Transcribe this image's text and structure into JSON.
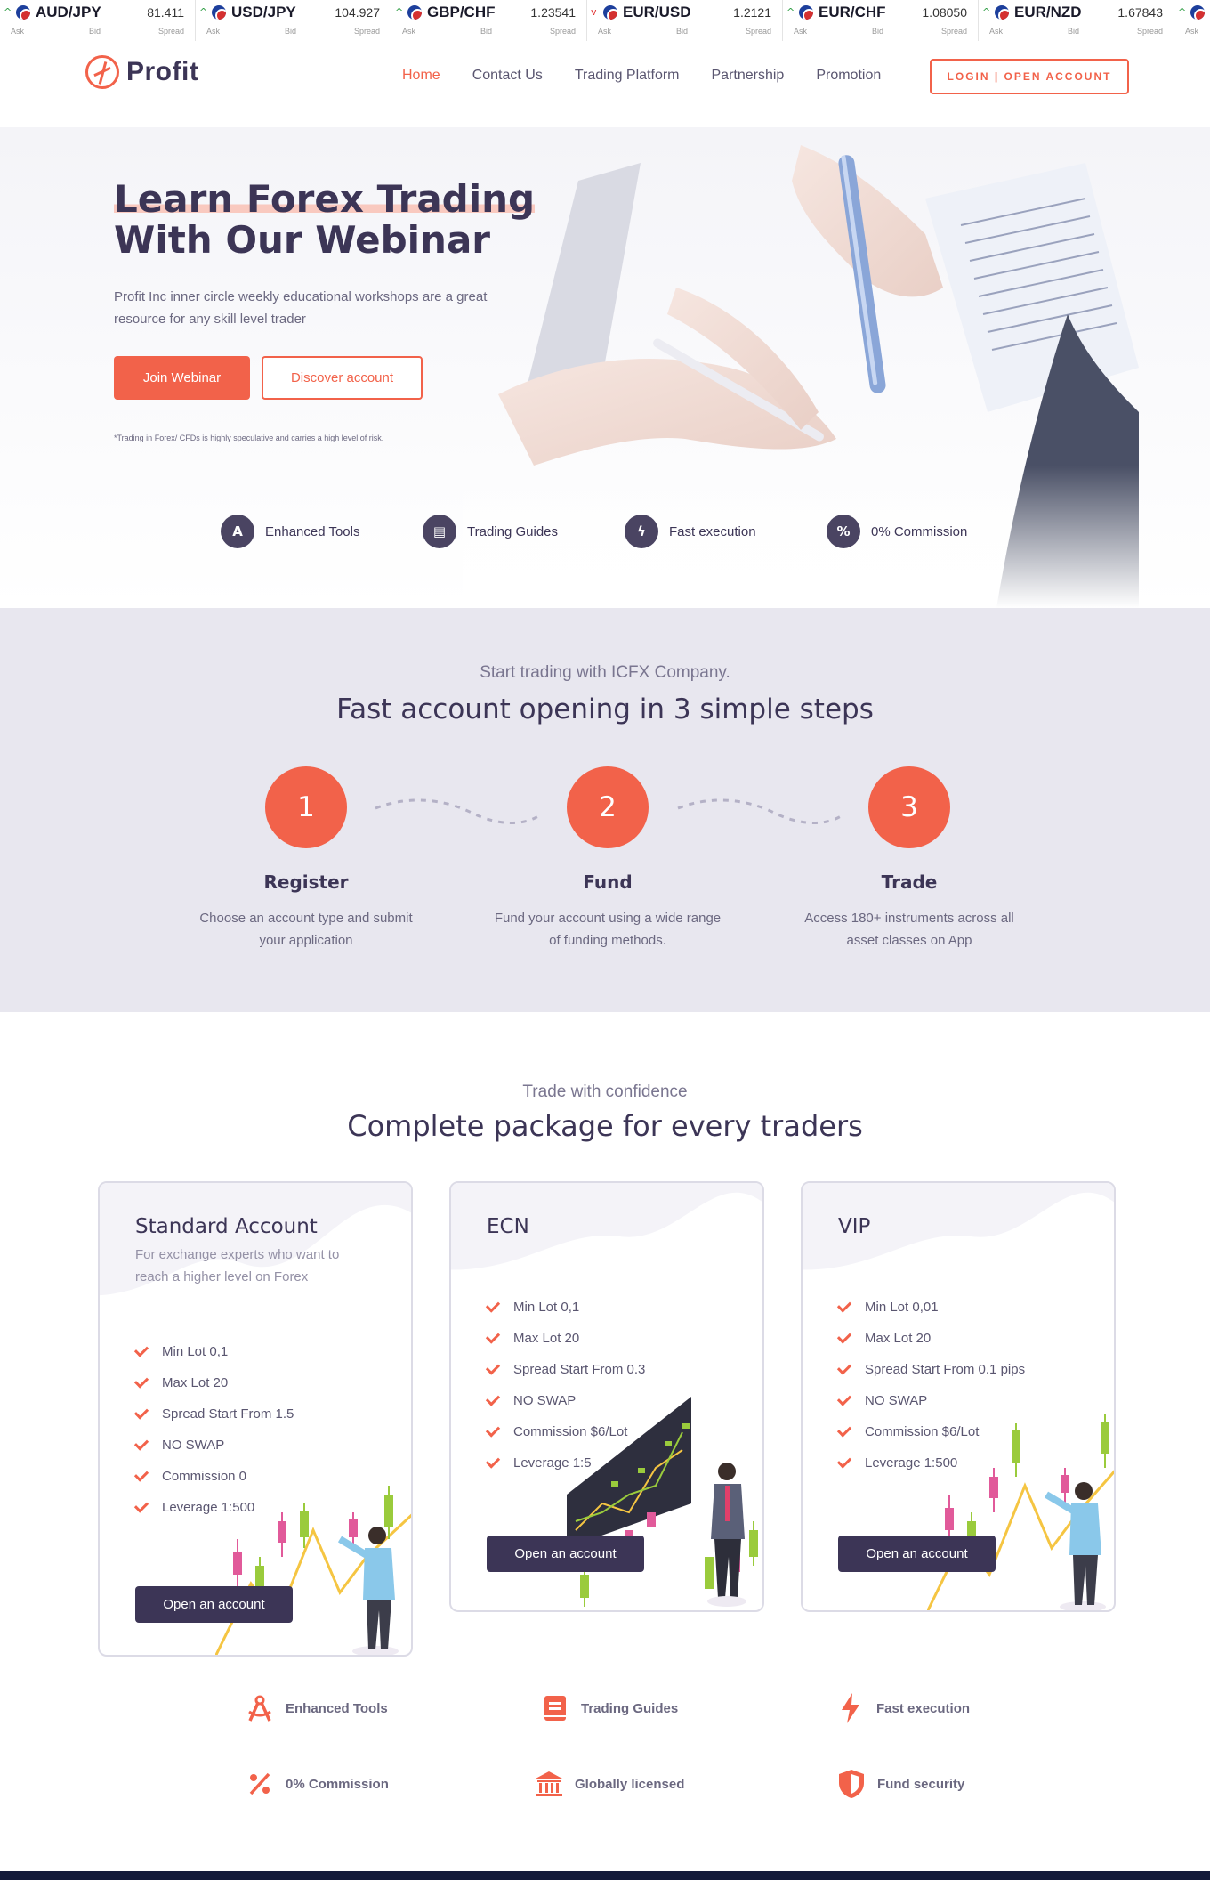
{
  "ticker": [
    {
      "pair": "AUD/JPY",
      "price": "81.411",
      "dir": "up",
      "ask": "Ask",
      "bid": "Bid",
      "spread": "Spread"
    },
    {
      "pair": "USD/JPY",
      "price": "104.927",
      "dir": "up",
      "ask": "Ask",
      "bid": "Bid",
      "spread": "Spread"
    },
    {
      "pair": "GBP/CHF",
      "price": "1.23541",
      "dir": "up",
      "ask": "Ask",
      "bid": "Bid",
      "spread": "Spread"
    },
    {
      "pair": "EUR/USD",
      "price": "1.2121",
      "dir": "down",
      "ask": "Ask",
      "bid": "Bid",
      "spread": "Spread"
    },
    {
      "pair": "EUR/CHF",
      "price": "1.08050",
      "dir": "up",
      "ask": "Ask",
      "bid": "Bid",
      "spread": "Spread"
    },
    {
      "pair": "EUR/NZD",
      "price": "1.67843",
      "dir": "up",
      "ask": "Ask",
      "bid": "Bid",
      "spread": "Spread"
    },
    {
      "pair": "",
      "price": "",
      "dir": "up",
      "ask": "Ask",
      "bid": "",
      "spread": ""
    }
  ],
  "header": {
    "logo_text": "Profit",
    "nav": [
      "Home",
      "Contact Us",
      "Trading Platform",
      "Partnership",
      "Promotion"
    ],
    "login_label": "LOGIN  |  OPEN ACCOUNT"
  },
  "hero": {
    "title_line1": "Learn Forex Trading",
    "title_line2": "With Our Webinar",
    "subtitle": "Profit Inc inner circle weekly educational workshops are a great resource for any skill level trader",
    "primary_button": "Join Webinar",
    "secondary_button": "Discover account",
    "risk_note": "*Trading in Forex/ CFDs is highly speculative and carries a high level of risk.",
    "features": [
      {
        "label": "Enhanced Tools",
        "icon": "compass-icon"
      },
      {
        "label": "Trading Guides",
        "icon": "book-icon"
      },
      {
        "label": "Fast execution",
        "icon": "bolt-icon"
      },
      {
        "label": "0% Commission",
        "icon": "percent-icon"
      }
    ]
  },
  "steps": {
    "kicker": "Start trading with ICFX Company.",
    "heading": "Fast account opening in 3 simple steps",
    "items": [
      {
        "number": "1",
        "title": "Register",
        "desc": "Choose an account type and submit your application"
      },
      {
        "number": "2",
        "title": "Fund",
        "desc": "Fund your account using a wide range of funding methods."
      },
      {
        "number": "3",
        "title": "Trade",
        "desc": "Access 180+ instruments across all asset classes on App"
      }
    ]
  },
  "packages": {
    "kicker": "Trade with confidence",
    "heading": "Complete package for every traders",
    "cards": [
      {
        "title": "Standard Account",
        "desc": "For exchange experts who want to reach a higher level on Forex",
        "items": [
          "Min Lot 0,1",
          "Max Lot 20",
          "Spread Start From 1.5",
          "NO SWAP",
          "Commission 0",
          "Leverage 1:500"
        ],
        "button": "Open an account"
      },
      {
        "title": "ECN",
        "desc": "",
        "items": [
          "Min Lot 0,1",
          "Max Lot 20",
          "Spread Start From 0.3",
          "NO SWAP",
          "Commission $6/Lot",
          "Leverage 1:5"
        ],
        "button": "Open an account"
      },
      {
        "title": "VIP",
        "desc": "",
        "items": [
          "Min Lot 0,01",
          "Max Lot 20",
          "Spread Start From 0.1 pips",
          "NO SWAP",
          "Commission $6/Lot",
          "Leverage 1:500"
        ],
        "button": "Open an account"
      }
    ]
  },
  "features": [
    {
      "label": "Enhanced Tools",
      "icon": "compass-icon"
    },
    {
      "label": "Trading Guides",
      "icon": "book-icon"
    },
    {
      "label": "Fast execution",
      "icon": "bolt-icon"
    },
    {
      "label": "0% Commission",
      "icon": "percent-icon"
    },
    {
      "label": "Globally licensed",
      "icon": "bank-icon"
    },
    {
      "label": "Fund security",
      "icon": "shield-icon"
    }
  ],
  "colors": {
    "accent": "#f2624a",
    "dark": "#3c3556",
    "band": "#e8e7ef"
  }
}
